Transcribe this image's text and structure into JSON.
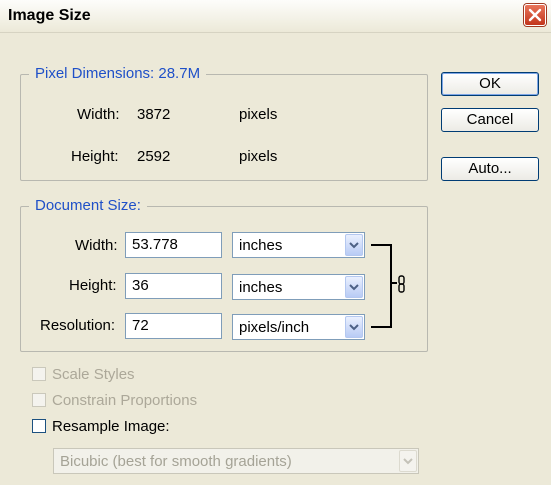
{
  "window": {
    "title": "Image Size"
  },
  "pixel_dimensions": {
    "legend": "Pixel Dimensions:  28.7M",
    "width_label": "Width:",
    "width_value": "3872",
    "width_unit": "pixels",
    "height_label": "Height:",
    "height_value": "2592",
    "height_unit": "pixels"
  },
  "document_size": {
    "legend": "Document Size:",
    "width_label": "Width:",
    "width_value": "53.778",
    "width_unit": "inches",
    "height_label": "Height:",
    "height_value": "36",
    "height_unit": "inches",
    "resolution_label": "Resolution:",
    "resolution_value": "72",
    "resolution_unit": "pixels/inch"
  },
  "options": {
    "scale_styles": "Scale Styles",
    "constrain_proportions": "Constrain Proportions",
    "resample_image": "Resample Image:",
    "resample_method": "Bicubic (best for smooth gradients)"
  },
  "buttons": {
    "ok": "OK",
    "cancel": "Cancel",
    "auto": "Auto..."
  }
}
